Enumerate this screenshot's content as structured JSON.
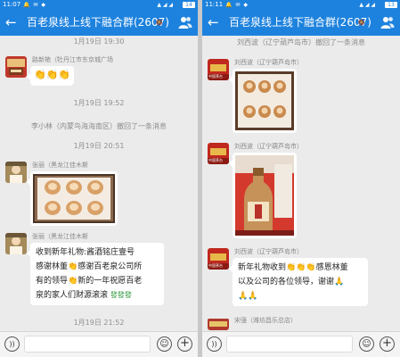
{
  "colors": {
    "primary": "#1d82de",
    "chat_bg": "#ebebeb",
    "bubble": "#ffffff",
    "clap": "#f2a20c"
  },
  "left": {
    "status": {
      "time": "11:07",
      "icons": "🔔 ✉ ◆",
      "signal": "▲ ◢ ◢",
      "battery": "14"
    },
    "title": "百老泉线上线下融合群(2607)",
    "mute_icon": "bell-off-icon",
    "times": {
      "t1": "1月19日 19:30",
      "t2": "1月19日 19:52",
      "t3": "1月19日 20:51",
      "t4": "1月19日 21:52"
    },
    "msg1": {
      "sender": "路新艳（牡丹江市东京城广场",
      "emojis": "👏👏👏"
    },
    "notice1": "李小林（内蒙鸟海海南区）撤回了一条消息",
    "msg2": {
      "sender": "张丽（黑龙江佳木斯"
    },
    "msg3": {
      "sender": "张丽（黑龙江佳木斯",
      "lines": [
        "收到新年礼物:酱酒铭庄壹号",
        "感谢林董",
        "感谢百老泉公司所",
        "有的领导",
        "新的一年祝愿百老",
        "泉的家人们财源滚滚 "
      ],
      "clap": "👏",
      "fortune": "發發發"
    },
    "input_placeholder": ""
  },
  "right": {
    "status": {
      "time": "11:11",
      "icons": "🔔 ✉ ◆",
      "signal": "▲ ◢ ◢",
      "battery": "13"
    },
    "title": "百老泉线上线下融合群(2607)",
    "mute_icon": "bell-off-icon",
    "notice1": "刘西波（辽宁葫芦岛市）撤回了一条消息",
    "msg1": {
      "sender": "刘西波（辽宁葫芦岛市）"
    },
    "msg2": {
      "sender": "刘西波（辽宁葫芦岛市）"
    },
    "msg3": {
      "sender": "刘西波（辽宁葫芦岛市）",
      "lines": [
        "新年礼物收到",
        "感恩林董",
        "以及公司的各位领导，谢谢",
        ""
      ],
      "clap": "👏👏👏",
      "clap2": "🙏",
      "hands": "🙏🙏"
    },
    "msg4": {
      "sender": "宋强（潍坊昌乐总店）"
    },
    "avatar_label": "中国茅台",
    "input_placeholder": ""
  }
}
